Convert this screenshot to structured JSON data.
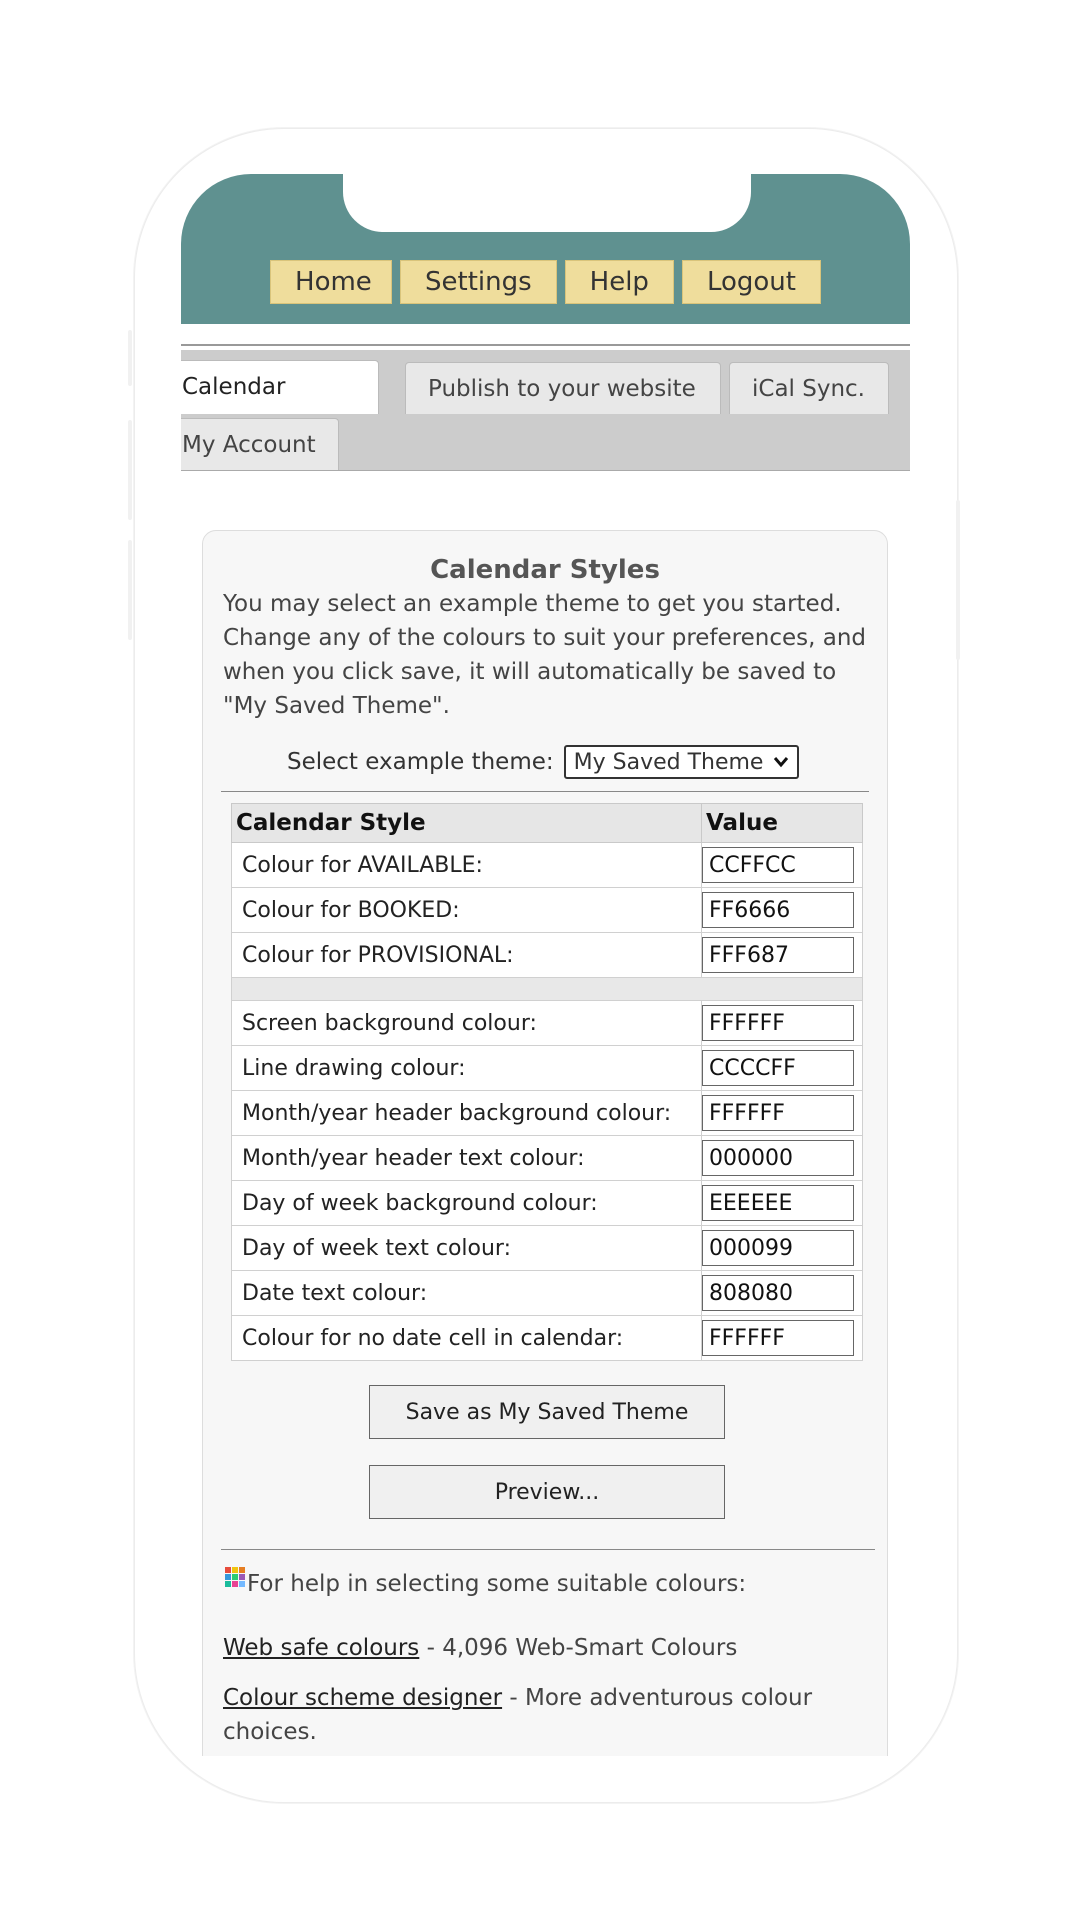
{
  "nav": {
    "items": [
      "Home",
      "Settings",
      "Help",
      "Logout"
    ]
  },
  "tabs": [
    {
      "label": "Calendar options",
      "active": true
    },
    {
      "label": "Publish to your website",
      "active": false
    },
    {
      "label": "iCal Sync.",
      "active": false
    },
    {
      "label": "My Account",
      "active": false
    }
  ],
  "card": {
    "title": "Calendar Styles",
    "intro": "You may select an example theme to get you started. Change any of the colours to suit your preferences, and when you click save, it will automatically be saved to \"My Saved Theme\".",
    "theme_label": "Select example theme:",
    "theme_value": "My Saved Theme"
  },
  "table": {
    "headers": [
      "Calendar Style",
      "Value"
    ],
    "group1": [
      {
        "label": "Colour for AVAILABLE:",
        "value": "CCFFCC"
      },
      {
        "label": "Colour for BOOKED:",
        "value": "FF6666"
      },
      {
        "label": "Colour for PROVISIONAL:",
        "value": "FFF687"
      }
    ],
    "group2": [
      {
        "label": "Screen background colour:",
        "value": "FFFFFF"
      },
      {
        "label": "Line drawing colour:",
        "value": "CCCCFF"
      },
      {
        "label": "Month/year header background colour:",
        "value": "FFFFFF"
      },
      {
        "label": "Month/year header text colour:",
        "value": "000000"
      },
      {
        "label": "Day of week background colour:",
        "value": "EEEEEE"
      },
      {
        "label": "Day of week text colour:",
        "value": "000099"
      },
      {
        "label": "Date text colour:",
        "value": "808080"
      },
      {
        "label": "Colour for no date cell in calendar:",
        "value": "FFFFFF"
      }
    ]
  },
  "buttons": {
    "save": "Save as My Saved Theme",
    "preview": "Preview..."
  },
  "help": {
    "intro": "For help in selecting some suitable colours:",
    "web_safe_link": "Web safe colours",
    "web_safe_desc": " - 4,096 Web-Smart Colours",
    "scheme_link": "Colour scheme designer",
    "scheme_desc": " - More adventurous colour choices."
  },
  "colors": {
    "header_bg": "#5f9190",
    "nav_button": "#efdd9c"
  }
}
